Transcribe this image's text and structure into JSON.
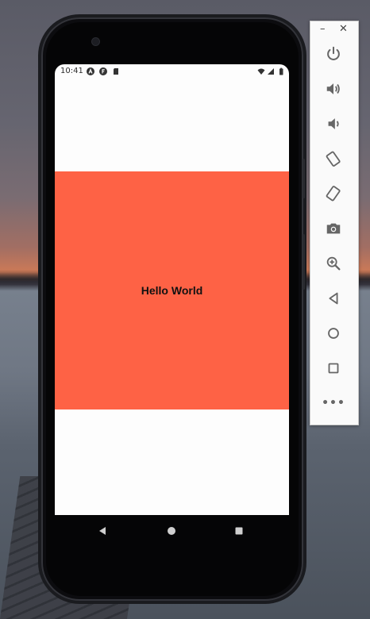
{
  "device": {
    "status_time": "10:41",
    "app_text": "Hello World",
    "box_color": "#fe6245",
    "status_icons": [
      "a-badge-icon",
      "f-badge-icon",
      "sd-card-icon",
      "wifi-icon",
      "signal-icon",
      "battery-icon"
    ]
  },
  "navigation": {
    "buttons": [
      "back-icon",
      "home-icon",
      "recents-icon"
    ]
  },
  "emulator_panel": {
    "minimize_label": "–",
    "close_label": "✕",
    "tools": [
      "power-icon",
      "volume-up-icon",
      "volume-down-icon",
      "rotate-left-icon",
      "rotate-right-icon",
      "camera-icon",
      "zoom-icon",
      "back-icon",
      "home-icon",
      "overview-icon",
      "more-icon"
    ],
    "more_label": "•••"
  }
}
